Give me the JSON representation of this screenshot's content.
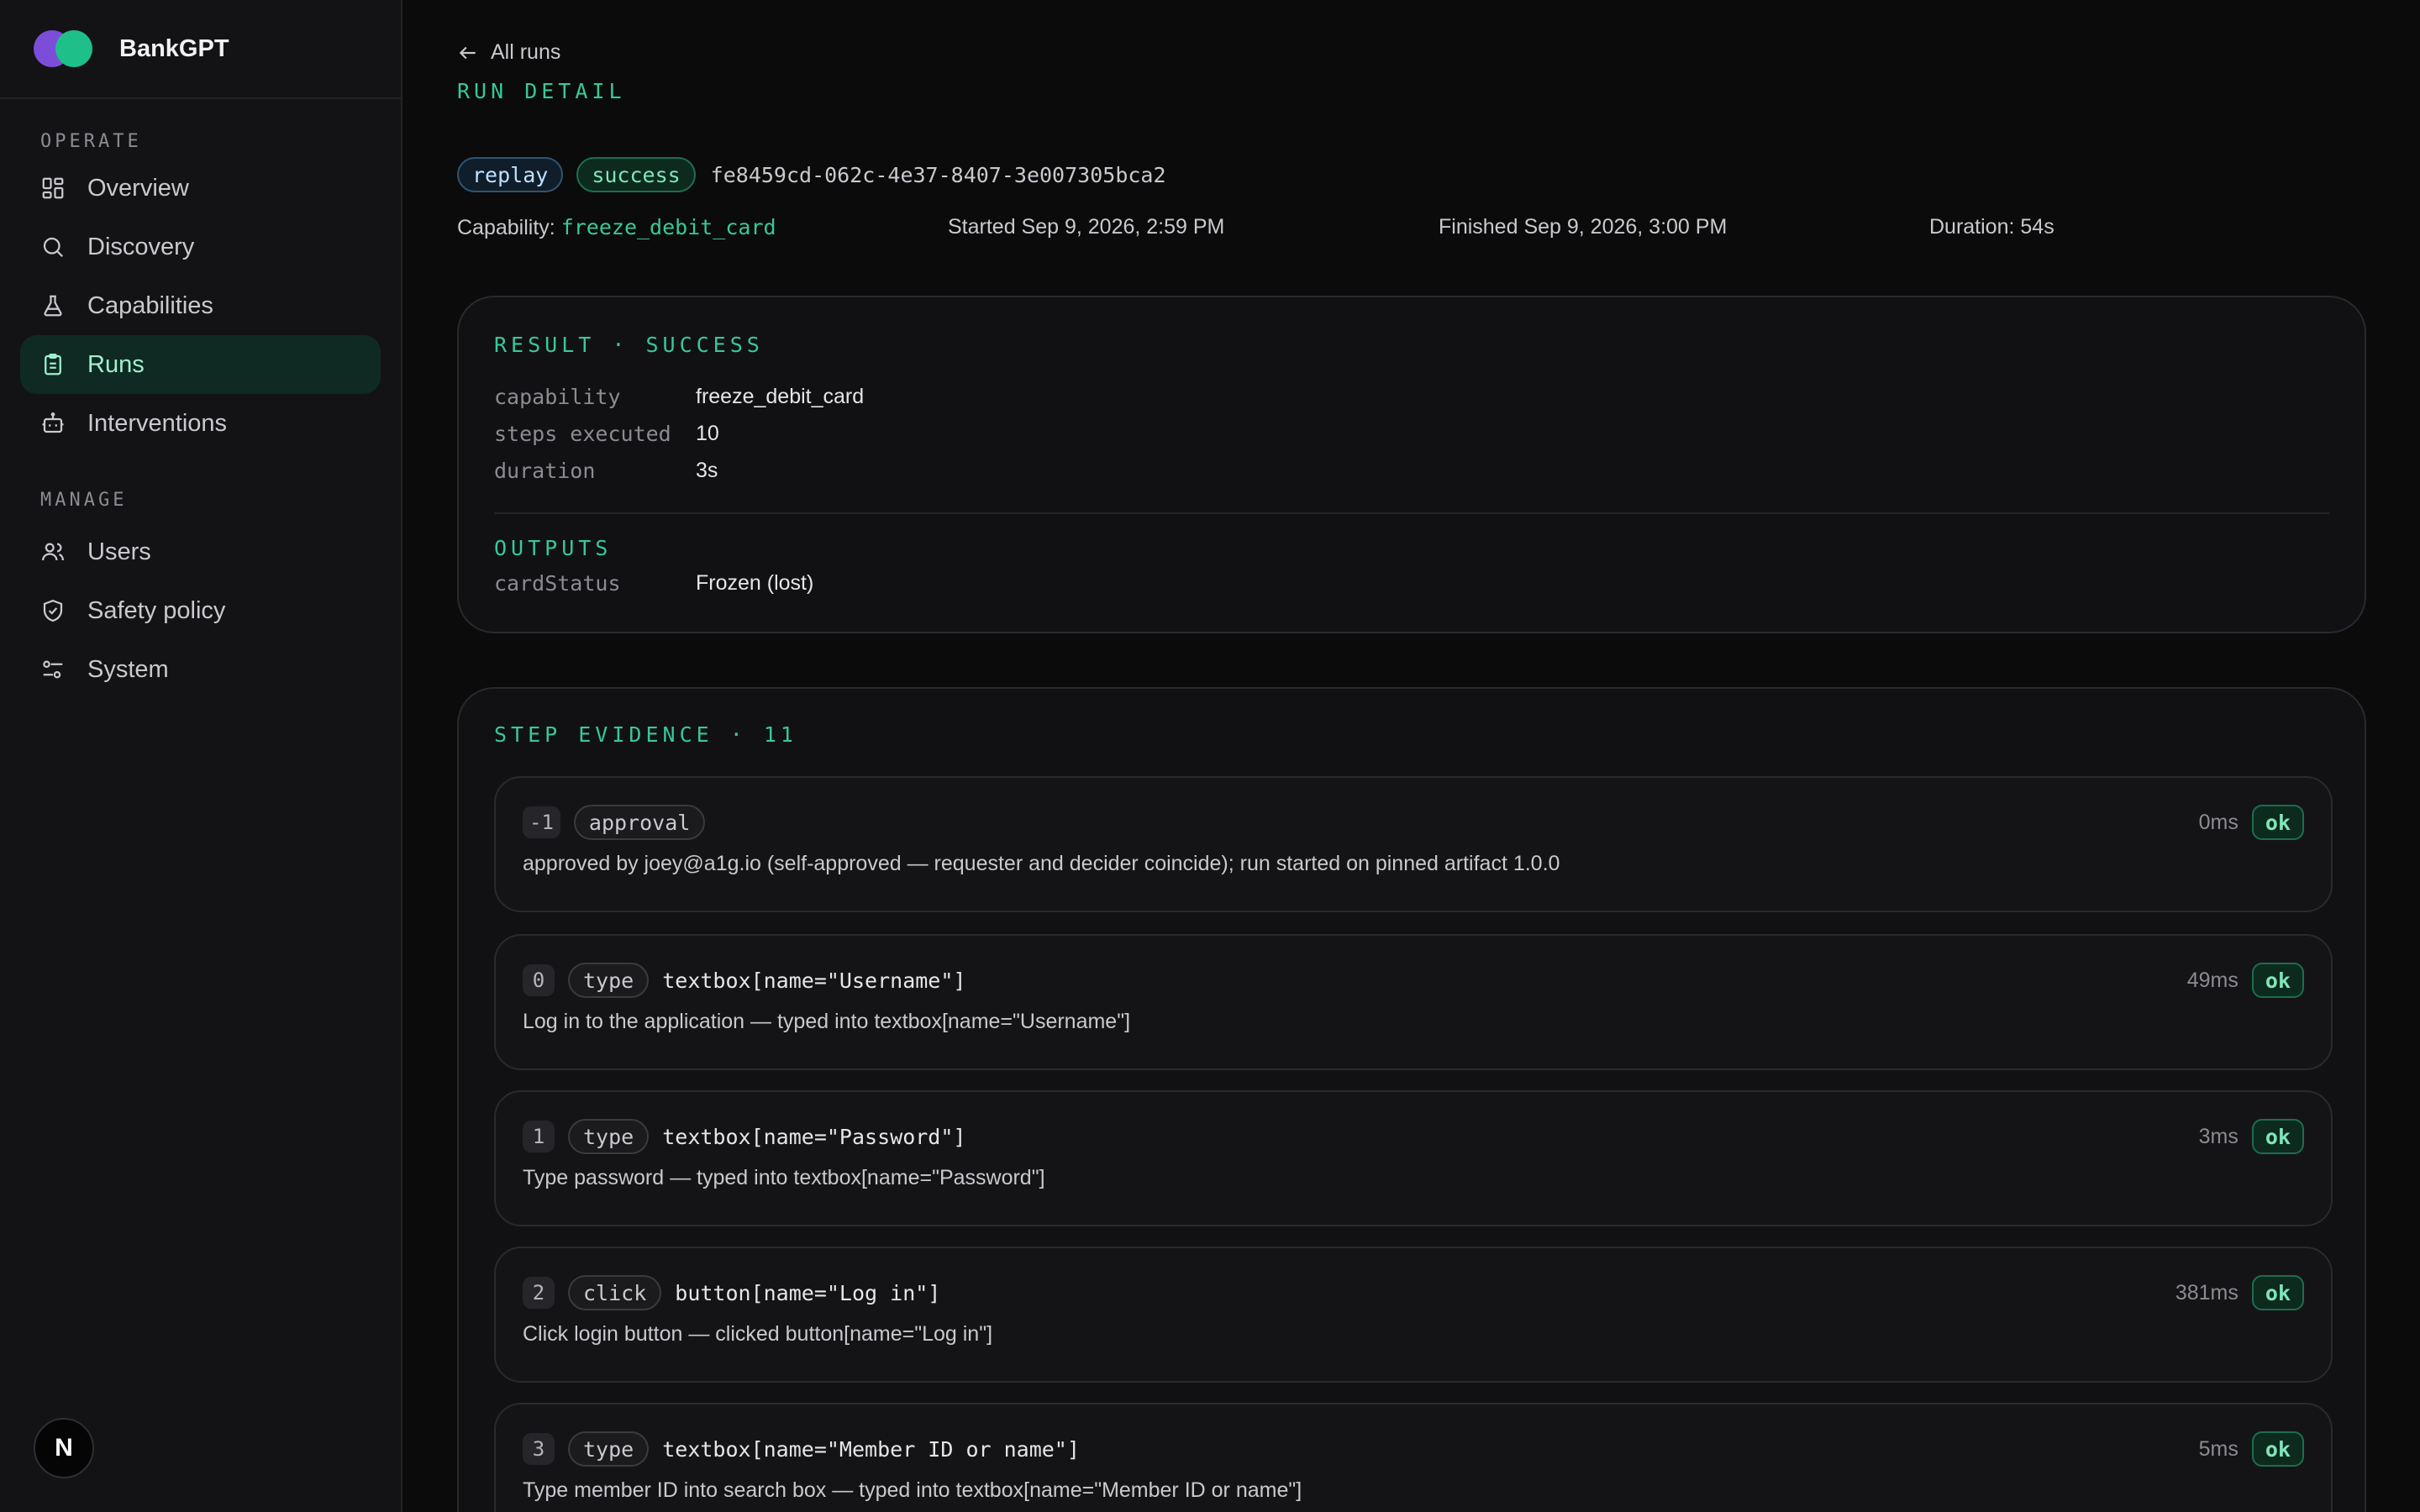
{
  "app": {
    "name": "BankGPT"
  },
  "sidebar": {
    "section_operate": "OPERATE",
    "section_manage": "MANAGE",
    "operate": [
      {
        "label": "Overview",
        "icon": "grid-icon"
      },
      {
        "label": "Discovery",
        "icon": "search-icon"
      },
      {
        "label": "Capabilities",
        "icon": "flask-icon"
      },
      {
        "label": "Runs",
        "icon": "clipboard-icon",
        "active": true
      },
      {
        "label": "Interventions",
        "icon": "robot-icon"
      }
    ],
    "manage": [
      {
        "label": "Users",
        "icon": "users-icon"
      },
      {
        "label": "Safety policy",
        "icon": "shield-icon"
      },
      {
        "label": "System",
        "icon": "sliders-icon"
      }
    ],
    "user_badge": "N"
  },
  "header": {
    "back_label": "All runs",
    "eyebrow": "RUN DETAIL",
    "mode_pill": "replay",
    "status_pill": "success",
    "run_id": "fe8459cd-062c-4e37-8407-3e007305bca2",
    "capability_label": "Capability:",
    "capability_value": "freeze_debit_card",
    "started": "Started Sep 9, 2026, 2:59 PM",
    "finished": "Finished Sep 9, 2026, 3:00 PM",
    "duration": "Duration: 54s"
  },
  "result": {
    "title": "RESULT · SUCCESS",
    "rows": [
      {
        "key": "capability",
        "value": "freeze_debit_card"
      },
      {
        "key": "steps executed",
        "value": "10"
      },
      {
        "key": "duration",
        "value": "3s"
      }
    ],
    "outputs_title": "OUTPUTS",
    "outputs": [
      {
        "key": "cardStatus",
        "value": "Frozen (lost)"
      }
    ]
  },
  "steps": {
    "title": "STEP EVIDENCE · 11",
    "items": [
      {
        "index": "-1",
        "action": "approval",
        "target": "",
        "duration": "0ms",
        "status": "ok",
        "description": "approved by joey@a1g.io (self-approved — requester and decider coincide); run started on pinned artifact 1.0.0"
      },
      {
        "index": "0",
        "action": "type",
        "target": "textbox[name=\"Username\"]",
        "duration": "49ms",
        "status": "ok",
        "description": "Log in to the application — typed into textbox[name=\"Username\"]"
      },
      {
        "index": "1",
        "action": "type",
        "target": "textbox[name=\"Password\"]",
        "duration": "3ms",
        "status": "ok",
        "description": "Type password — typed into textbox[name=\"Password\"]"
      },
      {
        "index": "2",
        "action": "click",
        "target": "button[name=\"Log in\"]",
        "duration": "381ms",
        "status": "ok",
        "description": "Click login button — clicked button[name=\"Log in\"]"
      },
      {
        "index": "3",
        "action": "type",
        "target": "textbox[name=\"Member ID or name\"]",
        "duration": "5ms",
        "status": "ok",
        "description": "Type member ID into search box — typed into textbox[name=\"Member ID or name\"]"
      }
    ]
  }
}
